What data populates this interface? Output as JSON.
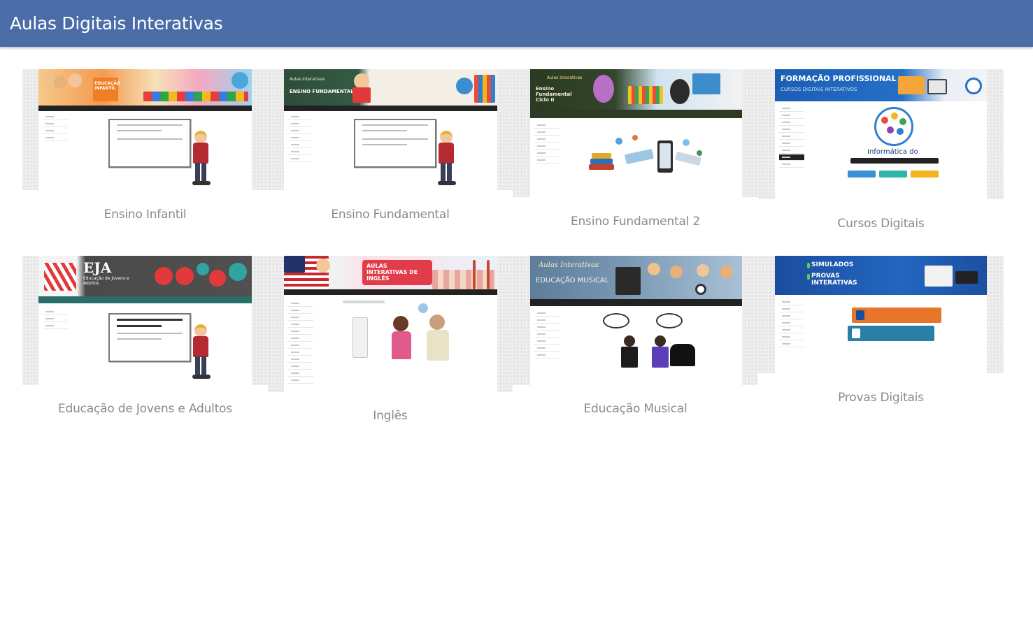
{
  "app": {
    "title": "Aulas Digitais Interativas"
  },
  "tiles": [
    {
      "caption": "Ensino Infantil",
      "banner_text": "EDUCAÇÃO INFANTIL",
      "accent": "#f08a24"
    },
    {
      "caption": "Ensino Fundamental",
      "banner_text": "Aulas Interativas",
      "banner_sub": "ENSINO FUNDAMENTAL I",
      "accent": "#2f4a3a"
    },
    {
      "caption": "Ensino Fundamental 2",
      "banner_text": "Aulas Interativas",
      "banner_sub": "Ensino Fundamental Ciclo II",
      "accent": "#2f3d2a"
    },
    {
      "caption": "Cursos Digitais",
      "banner_text": "FORMAÇÃO PROFISSIONAL",
      "banner_sub": "CURSOS DIGITAIS INTERATIVOS",
      "body_text": "Informática do",
      "accent": "#1f63b5"
    },
    {
      "caption": "Educação de Jovens e Adultos",
      "banner_text": "EJA",
      "banner_sub": "Educação de Jovens e Adultos",
      "accent": "#4a4a4a"
    },
    {
      "caption": "Inglês",
      "banner_text": "AULAS INTERATIVAS DE INGLÊS",
      "accent": "#e23c4a"
    },
    {
      "caption": "Educação Musical",
      "banner_text": "Aulas Interativas",
      "banner_sub": "EDUCAÇÃO MUSICAL",
      "accent": "#6e8fb0"
    },
    {
      "caption": "Provas Digitais",
      "banner_text": "SIMULADOS",
      "banner_sub": "PROVAS INTERATIVAS",
      "accent": "#1c4fa0"
    }
  ]
}
